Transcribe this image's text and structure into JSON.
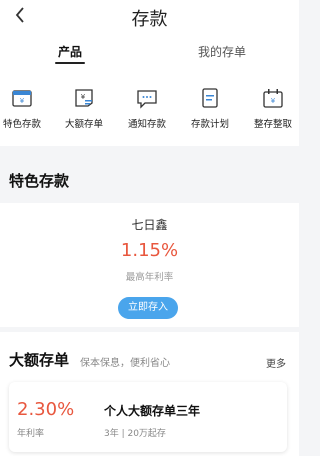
{
  "header": {
    "title": "存款",
    "back_icon": "chevron-left-icon"
  },
  "tabs": [
    {
      "label": "产品",
      "active": true
    },
    {
      "label": "我的存单",
      "active": false
    }
  ],
  "features": [
    {
      "label": "特色存款",
      "icon": "deposit-card-icon"
    },
    {
      "label": "大额存单",
      "icon": "large-deposit-icon"
    },
    {
      "label": "通知存款",
      "icon": "message-icon"
    },
    {
      "label": "存款计划",
      "icon": "plan-icon"
    },
    {
      "label": "整存整取",
      "icon": "calendar-yen-icon"
    }
  ],
  "special": {
    "section_title": "特色存款",
    "product_name": "七日鑫",
    "rate": "1.15%",
    "rate_label": "最高年利率",
    "button": "立即存入"
  },
  "large_deposit": {
    "section_title": "大额存单",
    "subtitle": "保本保息，便利省心",
    "more": "更多",
    "rate": "2.30%",
    "rate_label": "年利率",
    "product_name": "个人大额存单三年",
    "meta": "3年 | 20万起存"
  },
  "colors": {
    "accent_red": "#e8573e",
    "accent_blue": "#4aa5ec",
    "icon_blue": "#3a86d4"
  }
}
